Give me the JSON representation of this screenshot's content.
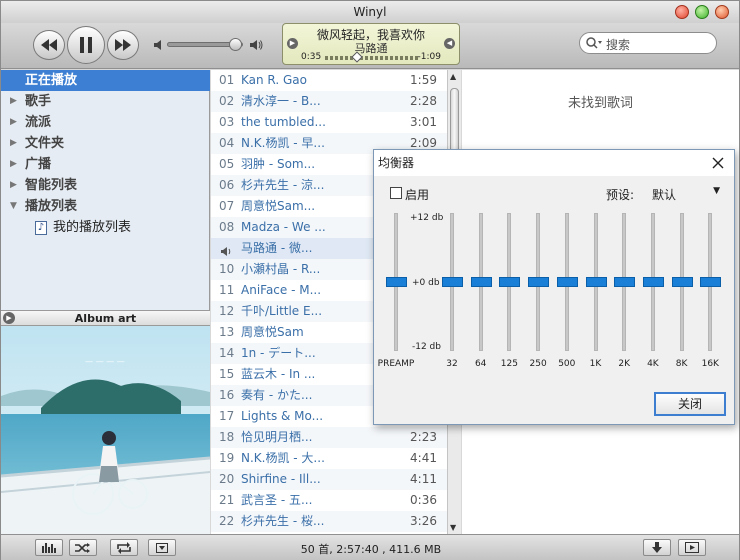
{
  "window": {
    "title": "Winyl"
  },
  "toolbar": {
    "now_playing": {
      "title": "微风轻起，我喜欢你",
      "artist": "马路通",
      "elapsed": "0:35",
      "remaining": "-1:09",
      "progress": 0.34
    },
    "volume": 0.9,
    "search_placeholder": "搜索"
  },
  "sources": [
    {
      "label": "正在播放",
      "selected": true,
      "arrow": false
    },
    {
      "label": "歌手",
      "arrow": true
    },
    {
      "label": "流派",
      "arrow": true
    },
    {
      "label": "文件夹",
      "arrow": true
    },
    {
      "label": "广播",
      "arrow": true
    },
    {
      "label": "智能列表",
      "arrow": true
    },
    {
      "label": "播放列表",
      "arrow": true,
      "expanded": true
    }
  ],
  "playlist_child": "我的播放列表",
  "album_art_label": "Album art",
  "tracks": [
    {
      "num": "01",
      "name": "Kan R. Gao",
      "dur": "1:59"
    },
    {
      "num": "02",
      "name": "清水淳一 - B...",
      "dur": "2:28"
    },
    {
      "num": "03",
      "name": "the tumbled...",
      "dur": "3:01"
    },
    {
      "num": "04",
      "name": "N.K.杨凯 - 早...",
      "dur": "2:09"
    },
    {
      "num": "05",
      "name": "羽肿 - Som...",
      "dur": ""
    },
    {
      "num": "06",
      "name": "杉卉先生 - 涼...",
      "dur": ""
    },
    {
      "num": "07",
      "name": "周意悦Sam...",
      "dur": ""
    },
    {
      "num": "08",
      "name": "Madza - We ...",
      "dur": ""
    },
    {
      "num": "",
      "name": "马路通 - 微...",
      "dur": "",
      "playing": true
    },
    {
      "num": "10",
      "name": "小瀬村晶 - R...",
      "dur": ""
    },
    {
      "num": "11",
      "name": "AniFace - M...",
      "dur": ""
    },
    {
      "num": "12",
      "name": "千卟/Little E...",
      "dur": ""
    },
    {
      "num": "13",
      "name": "周意悦Sam",
      "dur": ""
    },
    {
      "num": "14",
      "name": "1n - デート...",
      "dur": ""
    },
    {
      "num": "15",
      "name": "蓝云木 - In ...",
      "dur": ""
    },
    {
      "num": "16",
      "name": "奏有 - かた...",
      "dur": ""
    },
    {
      "num": "17",
      "name": "Lights & Mo...",
      "dur": ""
    },
    {
      "num": "18",
      "name": "恰见明月栖...",
      "dur": "2:23"
    },
    {
      "num": "19",
      "name": "N.K.杨凯 - 大...",
      "dur": "4:41"
    },
    {
      "num": "20",
      "name": "Shirfine - Ill...",
      "dur": "4:11"
    },
    {
      "num": "21",
      "name": "武言圣 - 五...",
      "dur": "0:36"
    },
    {
      "num": "22",
      "name": "杉卉先生 - 桜...",
      "dur": "3:26"
    }
  ],
  "lyrics": {
    "empty_text": "未找到歌词"
  },
  "status": {
    "summary": "50 首, 2:57:40 , 411.6 MB"
  },
  "equalizer": {
    "title": "均衡器",
    "enable_label": "启用",
    "preset_label": "预设:",
    "preset_value": "默认",
    "scale_top": "+12 db",
    "scale_mid": "+0 db",
    "scale_bottom": "-12 db",
    "preamp_label": "PREAMP",
    "preamp_value": 0,
    "bands": [
      {
        "label": "32",
        "value": 0
      },
      {
        "label": "64",
        "value": 0
      },
      {
        "label": "125",
        "value": 0
      },
      {
        "label": "250",
        "value": 0
      },
      {
        "label": "500",
        "value": 0
      },
      {
        "label": "1K",
        "value": 0
      },
      {
        "label": "2K",
        "value": 0
      },
      {
        "label": "4K",
        "value": 0
      },
      {
        "label": "8K",
        "value": 0
      },
      {
        "label": "16K",
        "value": 0
      }
    ],
    "close_label": "关闭"
  },
  "colors": {
    "accent": "#1a7fd6",
    "selection": "#3d7fd2",
    "playing_row": "#dfe8f4"
  }
}
